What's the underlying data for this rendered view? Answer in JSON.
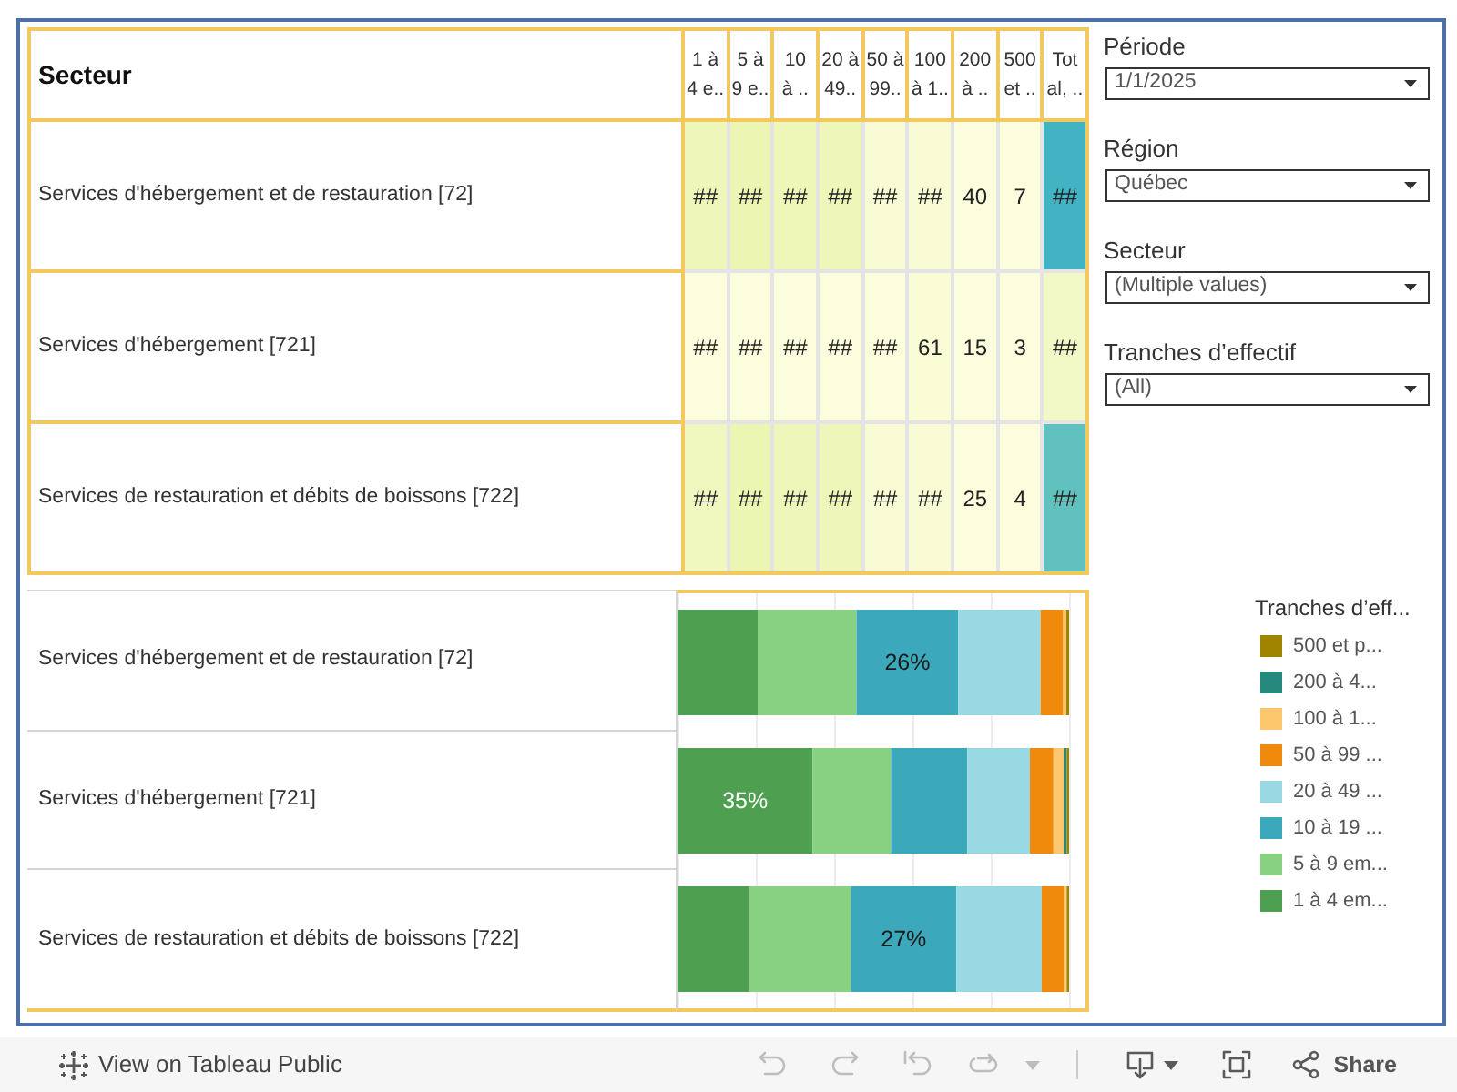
{
  "top_table": {
    "header": "Secteur",
    "columns": [
      "1 à\n4 e..",
      "5 à\n9 e..",
      "10\nà ..",
      "20 à\n49..",
      "50 à\n99..",
      "100\nà 1..",
      "200\nà ..",
      "500\net ..",
      "Tot\nal, .."
    ],
    "rows": [
      {
        "label": "Services d'hébergement et de restauration [72]",
        "cells": [
          {
            "text": "##",
            "color": "#eef7b9"
          },
          {
            "text": "##",
            "color": "#ecf6b2"
          },
          {
            "text": "##",
            "color": "#eef7b8"
          },
          {
            "text": "##",
            "color": "#eef7b9"
          },
          {
            "text": "##",
            "color": "#f8fbd3"
          },
          {
            "text": "##",
            "color": "#f8fbd3"
          },
          {
            "text": "40",
            "color": "#fcfddc"
          },
          {
            "text": "7",
            "color": "#fcfddc"
          },
          {
            "text": "##",
            "color": "#41b3c3"
          }
        ]
      },
      {
        "label": "Services d'hébergement [721]",
        "cells": [
          {
            "text": "##",
            "color": "#fcfddc"
          },
          {
            "text": "##",
            "color": "#fcfddc"
          },
          {
            "text": "##",
            "color": "#fcfddc"
          },
          {
            "text": "##",
            "color": "#fcfddc"
          },
          {
            "text": "##",
            "color": "#fcfddc"
          },
          {
            "text": "61",
            "color": "#f9fcd4"
          },
          {
            "text": "15",
            "color": "#fcfddc"
          },
          {
            "text": "3",
            "color": "#fcfddc"
          },
          {
            "text": "##",
            "color": "#f3f8c7"
          }
        ]
      },
      {
        "label": "Services de restauration et débits de boissons [722]",
        "cells": [
          {
            "text": "##",
            "color": "#f0f8bf"
          },
          {
            "text": "##",
            "color": "#ecf6b3"
          },
          {
            "text": "##",
            "color": "#eef7b9"
          },
          {
            "text": "##",
            "color": "#eef7b9"
          },
          {
            "text": "##",
            "color": "#f8fbd3"
          },
          {
            "text": "##",
            "color": "#f8fbd3"
          },
          {
            "text": "25",
            "color": "#fcfddc"
          },
          {
            "text": "4",
            "color": "#fcfddc"
          },
          {
            "text": "##",
            "color": "#60c1be"
          }
        ]
      }
    ]
  },
  "bar_section": {
    "rows": [
      {
        "label": "Services d'hébergement et de restauration [72]",
        "value_label": "26%"
      },
      {
        "label": "Services d'hébergement [721]",
        "value_label": "35%"
      },
      {
        "label": "Services de restauration et débits de boissons [722]",
        "value_label": "27%"
      }
    ]
  },
  "filters": [
    {
      "label": "Période",
      "value": "1/1/2025"
    },
    {
      "label": "Région",
      "value": "Québec"
    },
    {
      "label": "Secteur",
      "value": "(Multiple values)"
    },
    {
      "label": "Tranches d’effectif",
      "value": "(All)"
    }
  ],
  "legend": {
    "title": "Tranches d’eff...",
    "items": [
      {
        "label": "500 et p...",
        "color": "#a08400"
      },
      {
        "label": "200 à 4...",
        "color": "#26897e"
      },
      {
        "label": "100 à 1...",
        "color": "#fcc66d"
      },
      {
        "label": "50 à 99 ...",
        "color": "#ef8a0c"
      },
      {
        "label": "20 à 49 ...",
        "color": "#98d9e4"
      },
      {
        "label": "10 à 19 ...",
        "color": "#3ca8bc"
      },
      {
        "label": "5 à 9 em...",
        "color": "#87d180"
      },
      {
        "label": "1 à 4 em...",
        "color": "#4e9f50"
      }
    ]
  },
  "footer": {
    "link": "View on Tableau Public",
    "tools": [
      {
        "kind": "undo",
        "disabled": true
      },
      {
        "kind": "redo",
        "disabled": true
      },
      {
        "kind": "revert",
        "disabled": true
      },
      {
        "kind": "refresh",
        "disabled": true
      },
      {
        "kind": "more",
        "disabled": true
      },
      {
        "kind": "separator"
      },
      {
        "kind": "download",
        "disabled": false
      },
      {
        "kind": "fullscreen",
        "disabled": false
      },
      {
        "kind": "share",
        "label": "Share",
        "disabled": false
      }
    ]
  }
}
